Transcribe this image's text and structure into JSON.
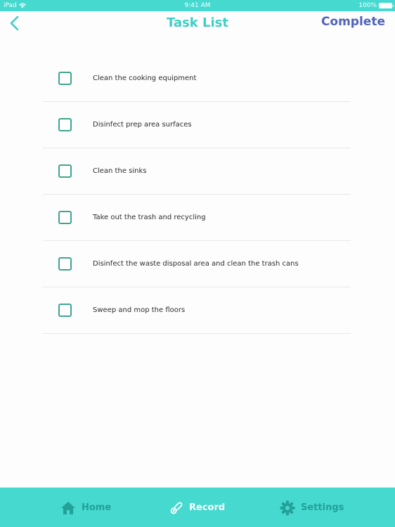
{
  "status_bar": {
    "device": "iPad",
    "time": "9:41 AM",
    "battery": "100%",
    "wifi_icon": "wifi-icon",
    "battery_icon": "battery-icon"
  },
  "nav": {
    "back_icon": "chevron-left-icon",
    "title": "Task List",
    "complete_label": "Complete"
  },
  "tasks": [
    {
      "label": "Clean the cooking equipment",
      "checked": false
    },
    {
      "label": "Disinfect prep area surfaces",
      "checked": false
    },
    {
      "label": "Clean the sinks",
      "checked": false
    },
    {
      "label": "Take out the trash and recycling",
      "checked": false
    },
    {
      "label": "Disinfect the waste disposal area and clean the trash cans",
      "checked": false
    },
    {
      "label": "Sweep and mop the floors",
      "checked": false
    }
  ],
  "tab_bar": {
    "tabs": [
      {
        "label": "Home",
        "icon": "home-icon",
        "active": false
      },
      {
        "label": "Record",
        "icon": "thermometer-icon",
        "active": true
      },
      {
        "label": "Settings",
        "icon": "gear-icon",
        "active": false
      }
    ]
  },
  "colors": {
    "accent": "#45d9d0",
    "title": "#3ecfc5",
    "complete": "#5064b8",
    "checkbox_border": "#3ea690",
    "tab_inactive": "#23a097",
    "tab_active": "#ffffff"
  }
}
